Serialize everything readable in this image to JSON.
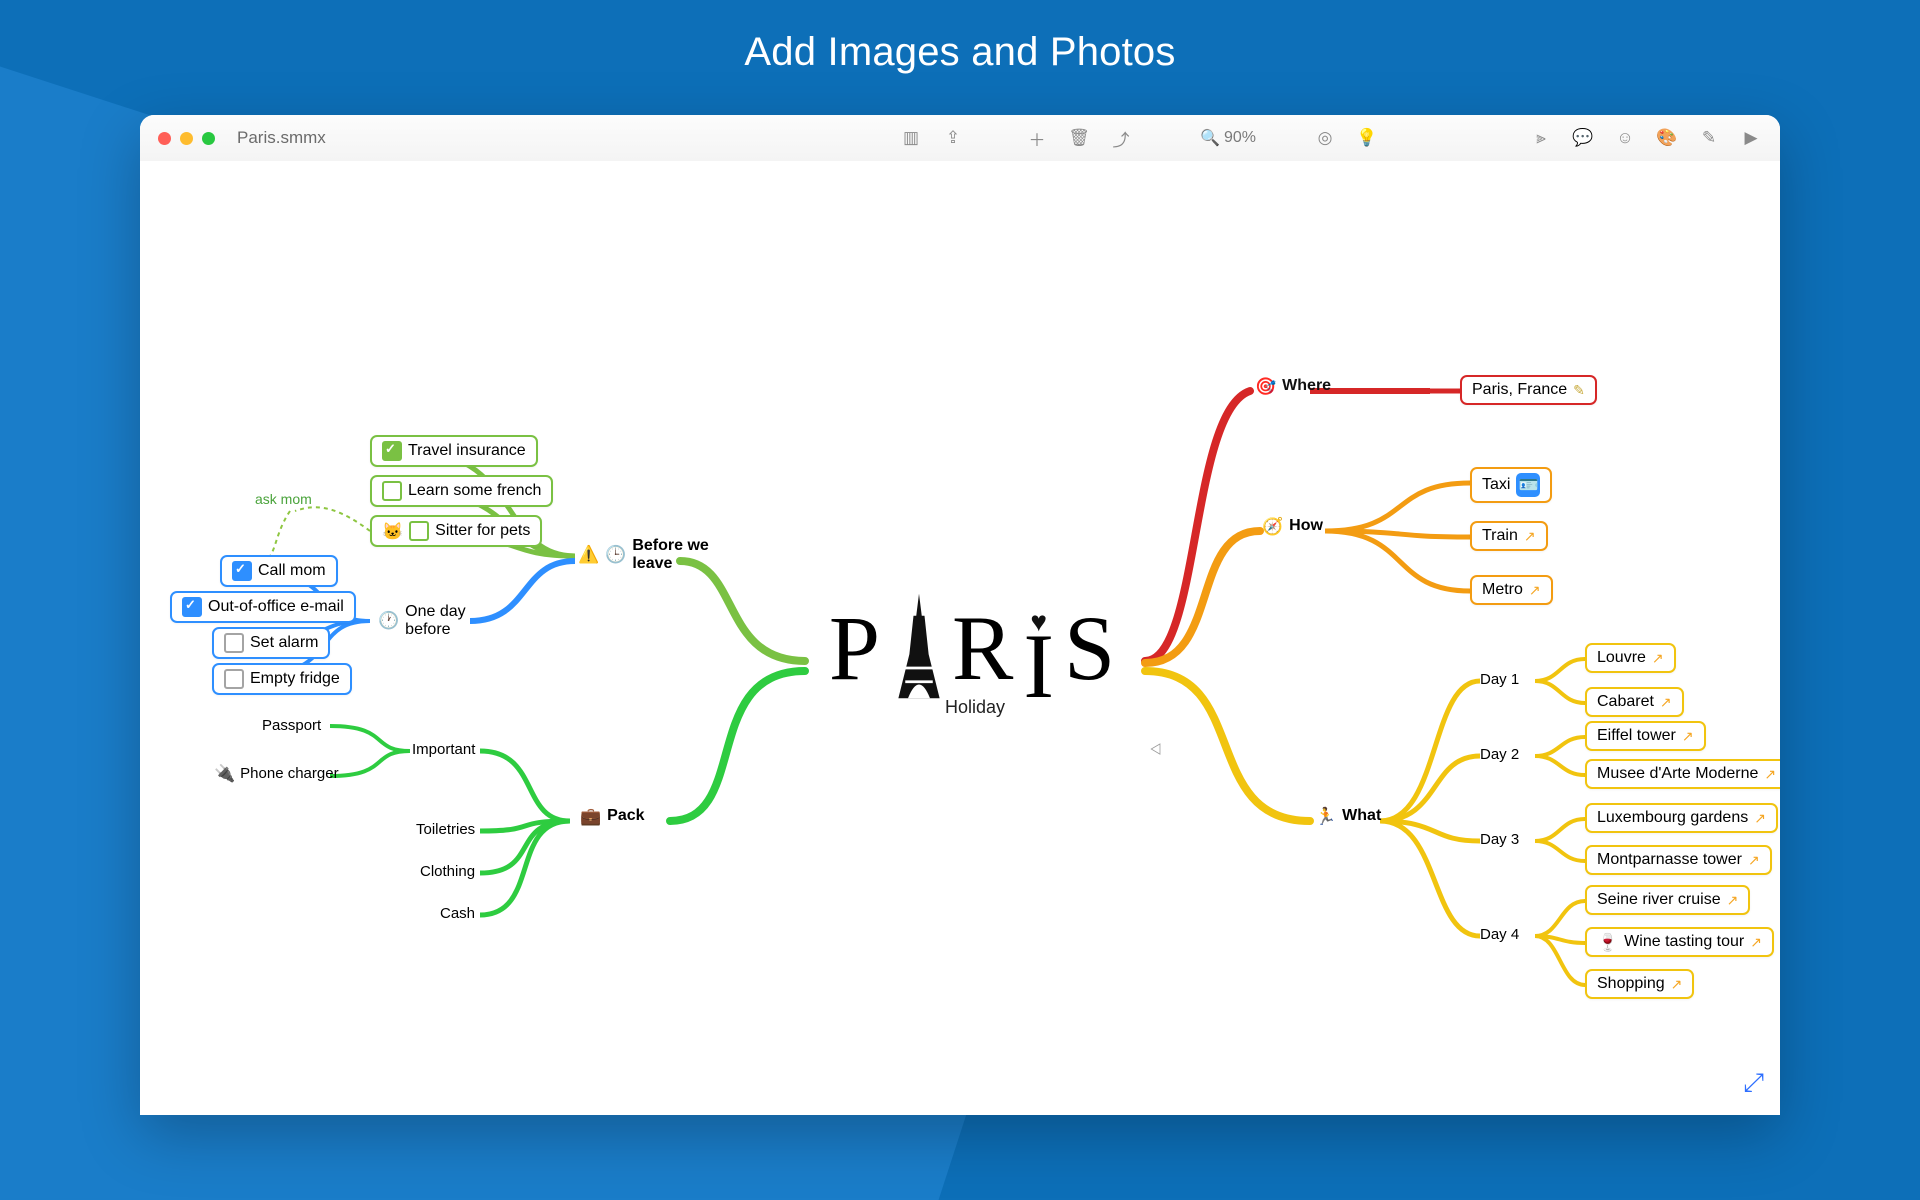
{
  "page_title": "Add Images and Photos",
  "filename": "Paris.smmx",
  "zoom": "90%",
  "central": {
    "title_letters": [
      "P",
      "R",
      "I",
      "S"
    ],
    "subtitle": "Holiday"
  },
  "where": {
    "label": "Where",
    "icon": "target-icon",
    "leaf": "Paris, France",
    "color": "#d62727"
  },
  "how": {
    "label": "How",
    "icon": "compass-icon",
    "color": "#f39c12",
    "items": [
      {
        "label": "Taxi",
        "trailing": "id-card-icon"
      },
      {
        "label": "Train",
        "trailing": "external-link-icon"
      },
      {
        "label": "Metro",
        "trailing": "external-link-icon"
      }
    ]
  },
  "what": {
    "label": "What",
    "icon": "runner-icon",
    "color": "#f1c40f",
    "days": [
      {
        "label": "Day 1",
        "items": [
          {
            "label": "Louvre",
            "trailing": "external-link-icon"
          },
          {
            "label": "Cabaret",
            "trailing": "external-link-icon"
          }
        ]
      },
      {
        "label": "Day 2",
        "items": [
          {
            "label": "Eiffel tower",
            "trailing": "external-link-icon"
          },
          {
            "label": "Musee d'Arte Moderne",
            "trailing": "external-link-icon"
          }
        ]
      },
      {
        "label": "Day 3",
        "items": [
          {
            "label": "Luxembourg gardens",
            "trailing": "external-link-icon"
          },
          {
            "label": "Montparnasse tower",
            "trailing": "external-link-icon"
          }
        ]
      },
      {
        "label": "Day 4",
        "items": [
          {
            "label": "Seine river cruise",
            "trailing": "external-link-icon"
          },
          {
            "label": "Wine tasting tour",
            "leading": "wine-icon",
            "trailing": "external-link-icon"
          },
          {
            "label": "Shopping",
            "trailing": "external-link-icon"
          }
        ]
      }
    ]
  },
  "before": {
    "label": "Before we leave",
    "icon": "warning-icon",
    "clock_icon": "clock-icon",
    "color": "#7ac143",
    "top_items": [
      {
        "label": "Travel insurance",
        "checked": true,
        "style": "green"
      },
      {
        "label": "Learn some french",
        "checked": false,
        "style": "green"
      },
      {
        "label": "Sitter for pets",
        "checked": false,
        "style": "green",
        "leading": "cat-icon"
      }
    ],
    "one_day": {
      "label": "One day before",
      "icon": "clock-icon",
      "color": "#2e8fff",
      "items": [
        {
          "label": "Call mom",
          "checked": true
        },
        {
          "label": "Out-of-office e-mail",
          "checked": true
        },
        {
          "label": "Set alarm",
          "checked": false
        },
        {
          "label": "Empty fridge",
          "checked": false
        }
      ]
    },
    "ask_mom_note": "ask mom"
  },
  "pack": {
    "label": "Pack",
    "icon": "briefcase-icon",
    "color": "#2ecc40",
    "important": {
      "label": "Important",
      "items": [
        {
          "label": "Passport"
        },
        {
          "label": "Phone charger",
          "leading": "plug-icon"
        }
      ]
    },
    "rest": [
      {
        "label": "Toiletries"
      },
      {
        "label": "Clothing"
      },
      {
        "label": "Cash"
      }
    ]
  },
  "toolbar_icons": [
    "panel-icon",
    "share-up-icon",
    "plus-icon",
    "trash-icon",
    "share-icon",
    "zoom-icon",
    "focus-icon",
    "lightbulb-icon",
    "slider-icon",
    "comment-icon",
    "emoji-icon",
    "palette-icon",
    "format-icon",
    "present-icon"
  ]
}
